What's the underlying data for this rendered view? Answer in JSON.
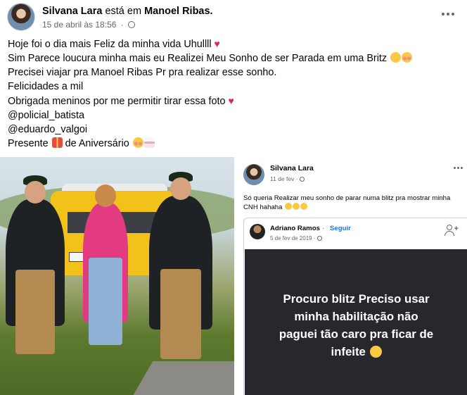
{
  "post": {
    "author": "Silvana Lara",
    "verb": "está em",
    "location": "Manoel Ribas.",
    "timestamp": "15 de abril às 18:56",
    "dot": "·",
    "lines": [
      "Hoje foi o dia mais Feliz da minha vida Uhullll",
      "Sim Parece loucura minha mais eu Realizei Meu Sonho de ser Parada em uma Britz",
      "Precisei viajar pra Manoel Ribas Pr pra realizar esse sonho.",
      "Felicidades a mil",
      "Obrigada meninos por me permitir tirar essa foto",
      "@policial_batista",
      "@eduardo_valgoi",
      "Presente",
      "de Aniversário"
    ],
    "heart": "♥"
  },
  "screenshot": {
    "author": "Silvana Lara",
    "date": "11 de fev",
    "text": "Só queria Realizar meu sonho de parar numa blitz pra mostrar minha CNH hahaha",
    "shared": {
      "author": "Adriano Ramos",
      "dot": "·",
      "follow": "Seguir",
      "date": "5 de fev de 2019",
      "card_lines": [
        "Procuro blitz Preciso usar",
        "minha habilitação não",
        "paguei tão caro pra ficar de",
        "infeite"
      ]
    }
  },
  "colors": {
    "link_blue": "#1877f2",
    "meta_gray": "#65676b",
    "heart_red": "#e0245e",
    "card_bg": "#27272d"
  },
  "icons": [
    "more-options-icon",
    "globe-icon",
    "heart-icon",
    "add-friend-icon"
  ]
}
